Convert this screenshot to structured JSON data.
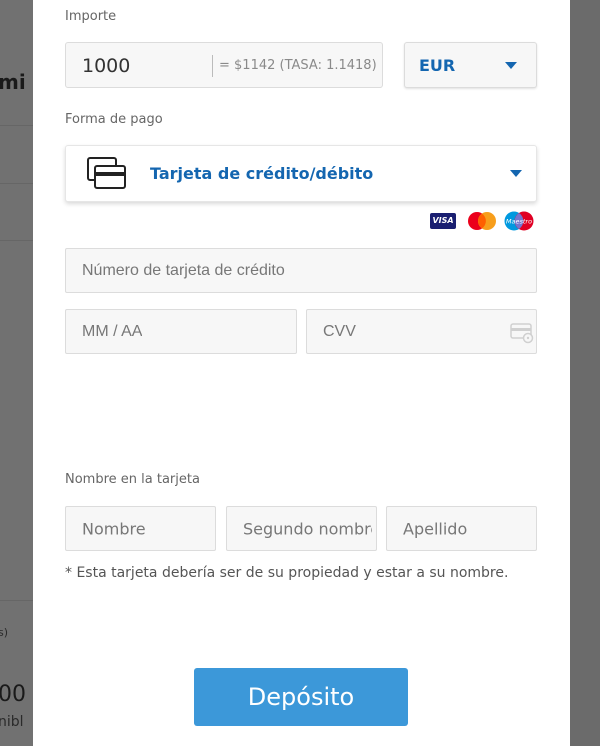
{
  "background": {
    "text1": "mi",
    "text2": "s)",
    "text3": "00",
    "text4": "nibl"
  },
  "amount": {
    "label": "Importe",
    "value": "1000",
    "conversion": "= $1142   (TASA: 1.1418)"
  },
  "currency": {
    "selected": "EUR"
  },
  "payment_method": {
    "label": "Forma de pago",
    "selected": "Tarjeta de crédito/débito",
    "icon": "credit-card-stack-icon"
  },
  "card_logos": {
    "visa": "VISA",
    "mastercard": "mastercard",
    "maestro": "Maestro"
  },
  "card": {
    "number_placeholder": "Número de tarjeta de crédito",
    "expiry_placeholder": "MM / AA",
    "cvv_placeholder": "CVV"
  },
  "name_on_card": {
    "label": "Nombre en la tarjeta",
    "first_placeholder": "Nombre",
    "middle_placeholder": "Segundo nombre",
    "last_placeholder": "Apellido"
  },
  "note": "* Esta tarjeta debería ser de su propiedad y estar a su nombre.",
  "deposit_button": "Depósito",
  "colors": {
    "accent": "#1466b0",
    "button": "#3c98d9"
  }
}
